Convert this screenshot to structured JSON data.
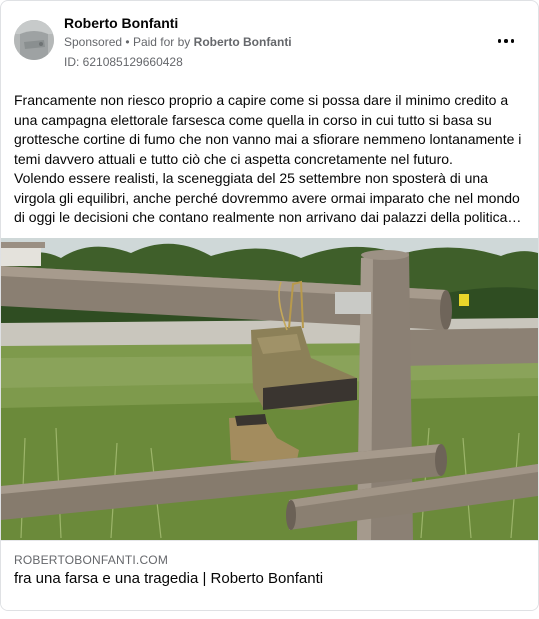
{
  "post": {
    "author": "Roberto Bonfanti",
    "sponsored_label": "Sponsored",
    "separator": "•",
    "paid_for_prefix": "Paid for by",
    "paid_for_name": "Roberto Bonfanti",
    "ad_id": "ID: 621085129660428",
    "more_icon": "more-horizontal-icon",
    "text_paragraph_1": "Francamente non riesco proprio a capire come si possa dare il minimo credito a una campagna elettorale farsesca come quella in corso in cui tutto si basa su grottesche cortine di fumo che non vanno mai a sfiorare nemmeno lontanamente i temi davvero attuali e tutto ciò che ci aspetta concretamente nel futuro.",
    "text_paragraph_2": "Volendo essere realisti, la sceneggiata del 25 settembre non sposterà di una virgola gli equilibri, anche perché dovremmo avere ormai imparato che nel mondo di oggi le decisioni che contano realmente non arrivano dai palazzi della politica…"
  },
  "link_preview": {
    "domain": "ROBERTOBONFANTI.COM",
    "title": "fra una farsa e una tragedia | Roberto Bonfanti"
  },
  "colors": {
    "text_primary": "#050505",
    "text_secondary": "#65676b",
    "border": "#dfe1e4"
  }
}
